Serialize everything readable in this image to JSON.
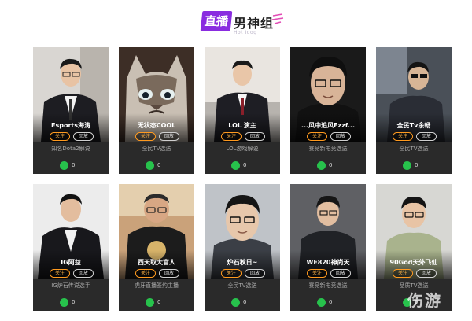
{
  "header": {
    "live_label": "直播",
    "title": "男神组",
    "subtitle": "Hot Idog"
  },
  "cards": [
    {
      "name": "Esports海涛",
      "follow": "关注",
      "replay": "回放",
      "desc": "知名Dota2解说",
      "count": "0"
    },
    {
      "name": "无状态COOL",
      "follow": "关注",
      "replay": "回放",
      "desc": "全民TV选送",
      "count": "0"
    },
    {
      "name": "LOL 演主",
      "follow": "关注",
      "replay": "回放",
      "desc": "LOL游戏解说",
      "count": "0"
    },
    {
      "name": "...风中追风Fzzf...",
      "follow": "关注",
      "replay": "回放",
      "desc": "赛竞新电竞选送",
      "count": "0"
    },
    {
      "name": "全民Tv余畅",
      "follow": "关注",
      "replay": "回放",
      "desc": "全民TV选送",
      "count": "0"
    },
    {
      "name": "IG阿益",
      "follow": "关注",
      "replay": "回放",
      "desc": "IG炉石传说选手",
      "count": "0"
    },
    {
      "name": "西天取大官人",
      "follow": "关注",
      "replay": "回放",
      "desc": "虎牙直播签约主播",
      "count": "0"
    },
    {
      "name": "炉石秋日~",
      "follow": "关注",
      "replay": "回放",
      "desc": "全民TV选送",
      "count": "0"
    },
    {
      "name": "WE820神尚天",
      "follow": "关注",
      "replay": "回放",
      "desc": "赛竞新电竞选送",
      "count": "0"
    },
    {
      "name": "90God天外飞仙",
      "follow": "关注",
      "replay": "回放",
      "desc": "品质TV选送",
      "count": "0"
    }
  ],
  "watermark": "伤游",
  "colors": {
    "accent": "#8a2ce0",
    "follow": "#ff9a1f",
    "stat": "#27c24c",
    "card_bg": "#2a2a2a"
  }
}
